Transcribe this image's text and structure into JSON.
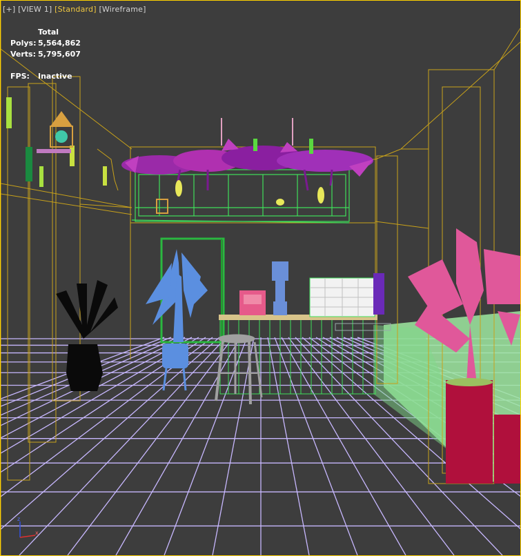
{
  "viewport": {
    "menu_plus": "[+]",
    "view_name": "[VIEW 1]",
    "shading_mode": "[Standard]",
    "display_mode": "[Wireframe]"
  },
  "stats": {
    "header": "Total",
    "polys_label": "Polys:",
    "polys_value": "5,564,862",
    "verts_label": "Verts:",
    "verts_value": "5,795,607",
    "fps_label": "FPS:",
    "fps_value": "Inactive"
  },
  "colors": {
    "viewport_border": "#ffd200",
    "background": "#3d3d3d",
    "floor_grid": "#c8b8ff",
    "wire_gold": "#c9a21a",
    "wire_green": "#3fe05a",
    "plant_pink": "#e0589a",
    "plant_blue": "#5b8fe0",
    "plant_purple": "#9a2aa8",
    "plant_black": "#0a0a0a",
    "pot_red": "#b0103c"
  },
  "scene_objects": [
    "floor-grid",
    "room-frame-wireframe",
    "hanging-shelf-wireframe",
    "counter-wireframe",
    "coffee-machine",
    "espresso-grinder",
    "display-cabinet",
    "bar-stool",
    "blue-potted-plant",
    "black-potted-plant",
    "pink-potted-plant",
    "purple-hanging-plants",
    "hanging-lamps",
    "wall-lantern"
  ],
  "axis_gizmo": {
    "x_color": "#e03030",
    "z_color": "#3050e0"
  }
}
